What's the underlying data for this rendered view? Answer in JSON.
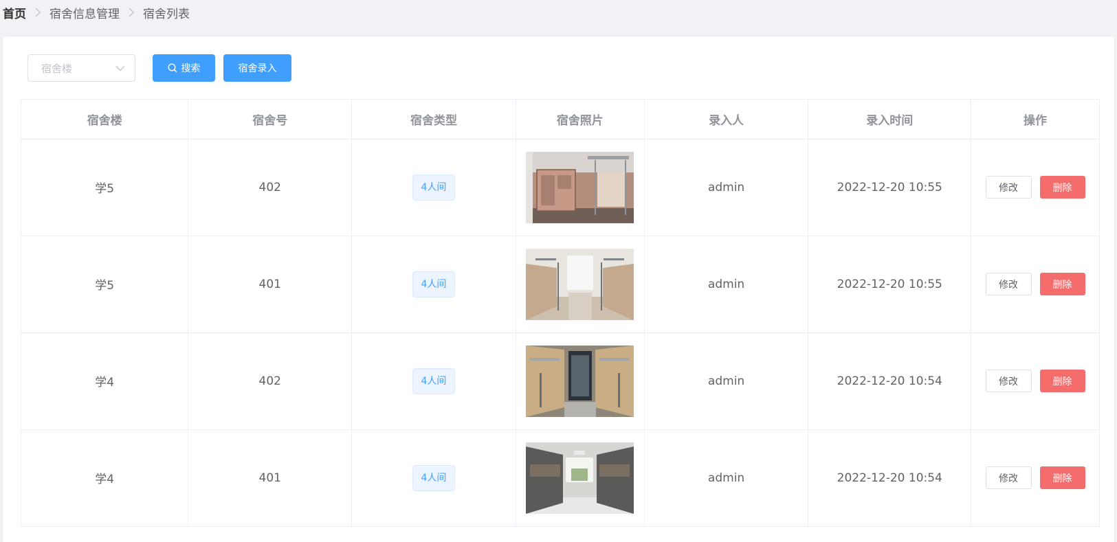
{
  "breadcrumb": {
    "home": "首页",
    "level2": "宿舍信息管理",
    "level3": "宿舍列表"
  },
  "toolbar": {
    "select_placeholder": "宿舍楼",
    "search_label": "搜索",
    "add_label": "宿舍录入"
  },
  "table": {
    "headers": [
      "宿舍楼",
      "宿舍号",
      "宿舍类型",
      "宿舍照片",
      "录入人",
      "录入时间",
      "操作"
    ],
    "rows": [
      {
        "building": "学5",
        "room": "402",
        "type": "4人间",
        "creator": "admin",
        "time": "2022-12-20 10:55"
      },
      {
        "building": "学5",
        "room": "401",
        "type": "4人间",
        "creator": "admin",
        "time": "2022-12-20 10:55"
      },
      {
        "building": "学4",
        "room": "402",
        "type": "4人间",
        "creator": "admin",
        "time": "2022-12-20 10:54"
      },
      {
        "building": "学4",
        "room": "401",
        "type": "4人间",
        "creator": "admin",
        "time": "2022-12-20 10:54"
      }
    ],
    "edit_label": "修改",
    "delete_label": "删除"
  },
  "colors": {
    "primary": "#409eff",
    "danger": "#f56c6c",
    "page_bg": "#f0f2f5"
  }
}
